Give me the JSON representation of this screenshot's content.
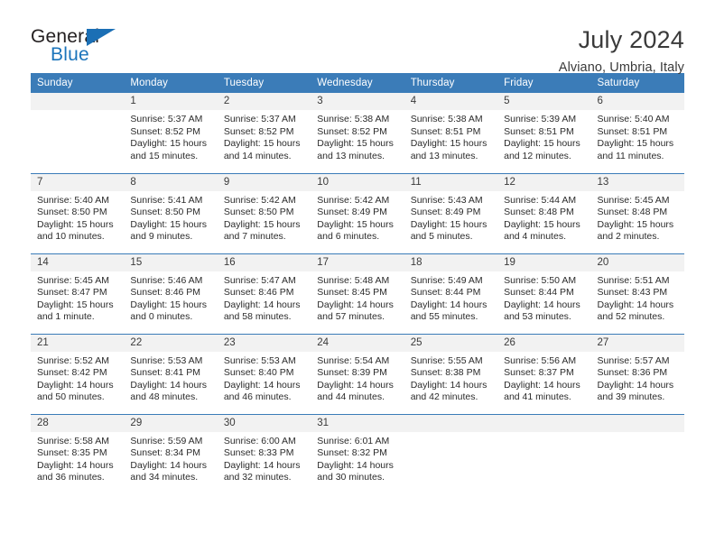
{
  "brand": {
    "name_part1": "General",
    "name_part2": "Blue"
  },
  "header": {
    "title": "July 2024",
    "subtitle": "Alviano, Umbria, Italy"
  },
  "colors": {
    "header_blue": "#3b7cb8",
    "logo_blue": "#1b74bb",
    "daynum_bg": "#f2f2f2"
  },
  "weekdays": [
    "Sunday",
    "Monday",
    "Tuesday",
    "Wednesday",
    "Thursday",
    "Friday",
    "Saturday"
  ],
  "weeks": [
    [
      {
        "day": "",
        "empty": true
      },
      {
        "day": "1",
        "sunrise": "Sunrise: 5:37 AM",
        "sunset": "Sunset: 8:52 PM",
        "daylight1": "Daylight: 15 hours",
        "daylight2": "and 15 minutes."
      },
      {
        "day": "2",
        "sunrise": "Sunrise: 5:37 AM",
        "sunset": "Sunset: 8:52 PM",
        "daylight1": "Daylight: 15 hours",
        "daylight2": "and 14 minutes."
      },
      {
        "day": "3",
        "sunrise": "Sunrise: 5:38 AM",
        "sunset": "Sunset: 8:52 PM",
        "daylight1": "Daylight: 15 hours",
        "daylight2": "and 13 minutes."
      },
      {
        "day": "4",
        "sunrise": "Sunrise: 5:38 AM",
        "sunset": "Sunset: 8:51 PM",
        "daylight1": "Daylight: 15 hours",
        "daylight2": "and 13 minutes."
      },
      {
        "day": "5",
        "sunrise": "Sunrise: 5:39 AM",
        "sunset": "Sunset: 8:51 PM",
        "daylight1": "Daylight: 15 hours",
        "daylight2": "and 12 minutes."
      },
      {
        "day": "6",
        "sunrise": "Sunrise: 5:40 AM",
        "sunset": "Sunset: 8:51 PM",
        "daylight1": "Daylight: 15 hours",
        "daylight2": "and 11 minutes."
      }
    ],
    [
      {
        "day": "7",
        "sunrise": "Sunrise: 5:40 AM",
        "sunset": "Sunset: 8:50 PM",
        "daylight1": "Daylight: 15 hours",
        "daylight2": "and 10 minutes."
      },
      {
        "day": "8",
        "sunrise": "Sunrise: 5:41 AM",
        "sunset": "Sunset: 8:50 PM",
        "daylight1": "Daylight: 15 hours",
        "daylight2": "and 9 minutes."
      },
      {
        "day": "9",
        "sunrise": "Sunrise: 5:42 AM",
        "sunset": "Sunset: 8:50 PM",
        "daylight1": "Daylight: 15 hours",
        "daylight2": "and 7 minutes."
      },
      {
        "day": "10",
        "sunrise": "Sunrise: 5:42 AM",
        "sunset": "Sunset: 8:49 PM",
        "daylight1": "Daylight: 15 hours",
        "daylight2": "and 6 minutes."
      },
      {
        "day": "11",
        "sunrise": "Sunrise: 5:43 AM",
        "sunset": "Sunset: 8:49 PM",
        "daylight1": "Daylight: 15 hours",
        "daylight2": "and 5 minutes."
      },
      {
        "day": "12",
        "sunrise": "Sunrise: 5:44 AM",
        "sunset": "Sunset: 8:48 PM",
        "daylight1": "Daylight: 15 hours",
        "daylight2": "and 4 minutes."
      },
      {
        "day": "13",
        "sunrise": "Sunrise: 5:45 AM",
        "sunset": "Sunset: 8:48 PM",
        "daylight1": "Daylight: 15 hours",
        "daylight2": "and 2 minutes."
      }
    ],
    [
      {
        "day": "14",
        "sunrise": "Sunrise: 5:45 AM",
        "sunset": "Sunset: 8:47 PM",
        "daylight1": "Daylight: 15 hours",
        "daylight2": "and 1 minute."
      },
      {
        "day": "15",
        "sunrise": "Sunrise: 5:46 AM",
        "sunset": "Sunset: 8:46 PM",
        "daylight1": "Daylight: 15 hours",
        "daylight2": "and 0 minutes."
      },
      {
        "day": "16",
        "sunrise": "Sunrise: 5:47 AM",
        "sunset": "Sunset: 8:46 PM",
        "daylight1": "Daylight: 14 hours",
        "daylight2": "and 58 minutes."
      },
      {
        "day": "17",
        "sunrise": "Sunrise: 5:48 AM",
        "sunset": "Sunset: 8:45 PM",
        "daylight1": "Daylight: 14 hours",
        "daylight2": "and 57 minutes."
      },
      {
        "day": "18",
        "sunrise": "Sunrise: 5:49 AM",
        "sunset": "Sunset: 8:44 PM",
        "daylight1": "Daylight: 14 hours",
        "daylight2": "and 55 minutes."
      },
      {
        "day": "19",
        "sunrise": "Sunrise: 5:50 AM",
        "sunset": "Sunset: 8:44 PM",
        "daylight1": "Daylight: 14 hours",
        "daylight2": "and 53 minutes."
      },
      {
        "day": "20",
        "sunrise": "Sunrise: 5:51 AM",
        "sunset": "Sunset: 8:43 PM",
        "daylight1": "Daylight: 14 hours",
        "daylight2": "and 52 minutes."
      }
    ],
    [
      {
        "day": "21",
        "sunrise": "Sunrise: 5:52 AM",
        "sunset": "Sunset: 8:42 PM",
        "daylight1": "Daylight: 14 hours",
        "daylight2": "and 50 minutes."
      },
      {
        "day": "22",
        "sunrise": "Sunrise: 5:53 AM",
        "sunset": "Sunset: 8:41 PM",
        "daylight1": "Daylight: 14 hours",
        "daylight2": "and 48 minutes."
      },
      {
        "day": "23",
        "sunrise": "Sunrise: 5:53 AM",
        "sunset": "Sunset: 8:40 PM",
        "daylight1": "Daylight: 14 hours",
        "daylight2": "and 46 minutes."
      },
      {
        "day": "24",
        "sunrise": "Sunrise: 5:54 AM",
        "sunset": "Sunset: 8:39 PM",
        "daylight1": "Daylight: 14 hours",
        "daylight2": "and 44 minutes."
      },
      {
        "day": "25",
        "sunrise": "Sunrise: 5:55 AM",
        "sunset": "Sunset: 8:38 PM",
        "daylight1": "Daylight: 14 hours",
        "daylight2": "and 42 minutes."
      },
      {
        "day": "26",
        "sunrise": "Sunrise: 5:56 AM",
        "sunset": "Sunset: 8:37 PM",
        "daylight1": "Daylight: 14 hours",
        "daylight2": "and 41 minutes."
      },
      {
        "day": "27",
        "sunrise": "Sunrise: 5:57 AM",
        "sunset": "Sunset: 8:36 PM",
        "daylight1": "Daylight: 14 hours",
        "daylight2": "and 39 minutes."
      }
    ],
    [
      {
        "day": "28",
        "sunrise": "Sunrise: 5:58 AM",
        "sunset": "Sunset: 8:35 PM",
        "daylight1": "Daylight: 14 hours",
        "daylight2": "and 36 minutes."
      },
      {
        "day": "29",
        "sunrise": "Sunrise: 5:59 AM",
        "sunset": "Sunset: 8:34 PM",
        "daylight1": "Daylight: 14 hours",
        "daylight2": "and 34 minutes."
      },
      {
        "day": "30",
        "sunrise": "Sunrise: 6:00 AM",
        "sunset": "Sunset: 8:33 PM",
        "daylight1": "Daylight: 14 hours",
        "daylight2": "and 32 minutes."
      },
      {
        "day": "31",
        "sunrise": "Sunrise: 6:01 AM",
        "sunset": "Sunset: 8:32 PM",
        "daylight1": "Daylight: 14 hours",
        "daylight2": "and 30 minutes."
      },
      {
        "day": "",
        "empty": true
      },
      {
        "day": "",
        "empty": true
      },
      {
        "day": "",
        "empty": true
      }
    ]
  ]
}
